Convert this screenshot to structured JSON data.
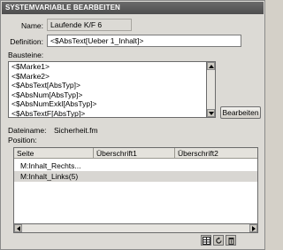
{
  "dialog": {
    "title": "SYSTEMVARIABLE BEARBEITEN"
  },
  "form": {
    "name_label": "Name:",
    "name_value": "Laufende K/F 6",
    "definition_label": "Definition:",
    "definition_value": "<$AbsText[Ueber 1_Inhalt]>",
    "bausteine_label": "Bausteine:"
  },
  "bausteine": {
    "items": [
      "<$Marke1>",
      "<$Marke2>",
      "<$AbsText[AbsTyp]>",
      "<$AbsNum[AbsTyp]>",
      "<$AbsNumExkl[AbsTyp]>",
      "<$AbsTextF[AbsTyp]>"
    ],
    "edit_button": "Bearbeiten"
  },
  "file": {
    "dateiname_label": "Dateiname:",
    "dateiname_value": "Sicherheit.fm",
    "position_label": "Position:"
  },
  "table": {
    "columns": [
      "Seite",
      "Überschrift1",
      "Überschrift2"
    ],
    "rows": [
      {
        "seite": "M:Inhalt_Rechts...",
        "selected": false
      },
      {
        "seite": "M:Inhalt_Links(5)",
        "selected": true
      }
    ]
  },
  "icons": {
    "toolbar": [
      "table-icon",
      "refresh-icon",
      "trash-icon"
    ],
    "scroll": [
      "arrow-up-icon",
      "arrow-down-icon",
      "arrow-left-icon",
      "arrow-right-icon"
    ]
  }
}
